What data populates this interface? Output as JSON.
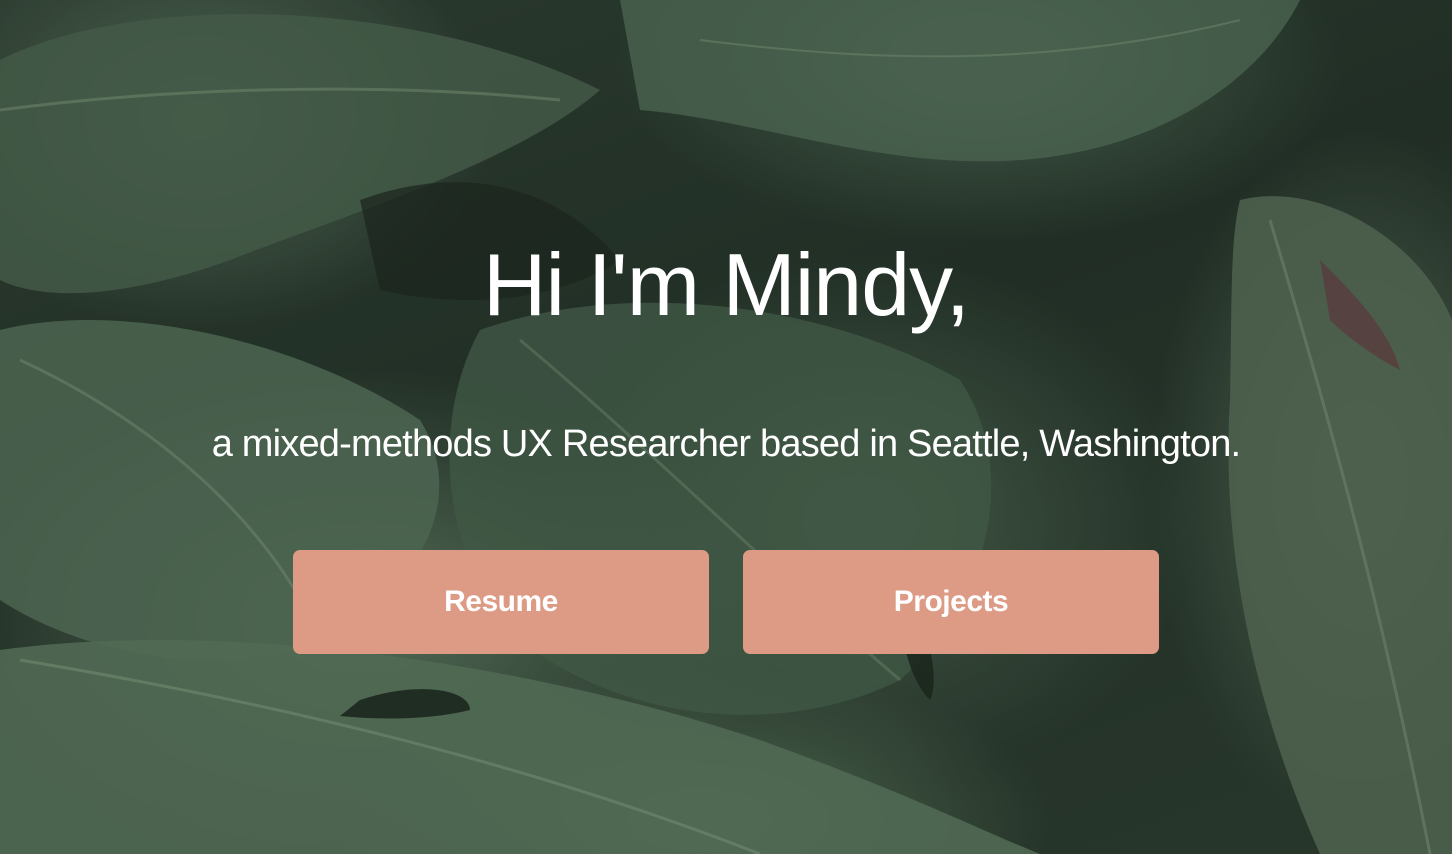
{
  "hero": {
    "headline": "Hi I'm Mindy,",
    "tagline": "a mixed-methods UX Researcher based in Seattle, Washington.",
    "background_image": "monstera-leaves-photo"
  },
  "buttons": {
    "resume_label": "Resume",
    "projects_label": "Projects"
  },
  "colors": {
    "button_bg": "#dd9a84",
    "text": "#ffffff",
    "leaf_green": "#4f6a55"
  }
}
